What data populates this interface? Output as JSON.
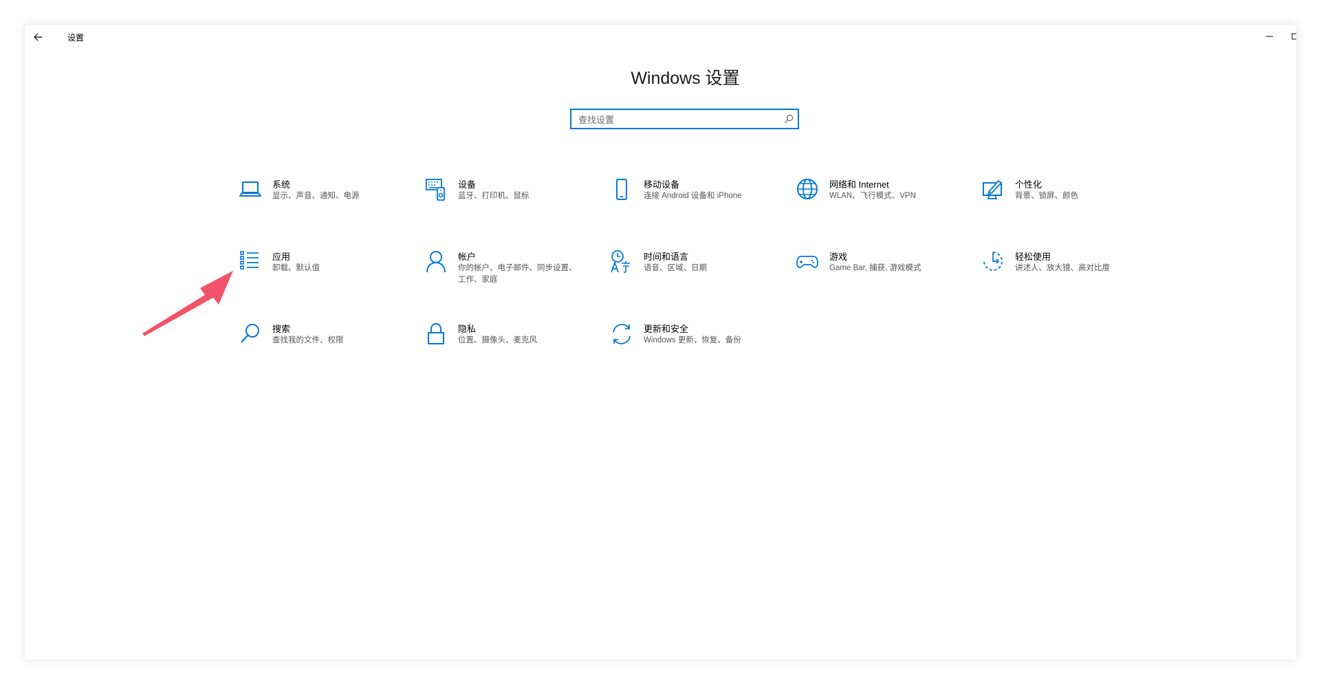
{
  "window": {
    "title": "设置"
  },
  "page": {
    "heading": "Windows 设置"
  },
  "search": {
    "placeholder": "查找设置",
    "value": ""
  },
  "accent_color": "#0078d7",
  "annotation_arrow_color": "#f0536a",
  "tiles": [
    {
      "title": "系统",
      "desc": "显示、声音、通知、电源",
      "icon": "laptop-icon"
    },
    {
      "title": "设备",
      "desc": "蓝牙、打印机、鼠标",
      "icon": "keyboard-icon"
    },
    {
      "title": "移动设备",
      "desc": "连接 Android 设备和 iPhone",
      "icon": "phone-icon"
    },
    {
      "title": "网络和 Internet",
      "desc": "WLAN、飞行模式、VPN",
      "icon": "globe-icon"
    },
    {
      "title": "个性化",
      "desc": "背景、锁屏、颜色",
      "icon": "paint-icon"
    },
    {
      "title": "应用",
      "desc": "卸载、默认值",
      "icon": "apps-list-icon"
    },
    {
      "title": "帐户",
      "desc": "你的帐户、电子邮件、同步设置、工作、家庭",
      "icon": "person-icon"
    },
    {
      "title": "时间和语言",
      "desc": "语音、区域、日期",
      "icon": "time-language-icon"
    },
    {
      "title": "游戏",
      "desc": "Game Bar, 捕获, 游戏模式",
      "icon": "gamepad-icon"
    },
    {
      "title": "轻松使用",
      "desc": "讲述人、放大镜、高对比度",
      "icon": "ease-of-access-icon"
    },
    {
      "title": "搜索",
      "desc": "查找我的文件、权限",
      "icon": "search-magnifier-icon"
    },
    {
      "title": "隐私",
      "desc": "位置、摄像头、麦克风",
      "icon": "lock-icon"
    },
    {
      "title": "更新和安全",
      "desc": "Windows 更新、恢复、备份",
      "icon": "update-icon"
    }
  ]
}
